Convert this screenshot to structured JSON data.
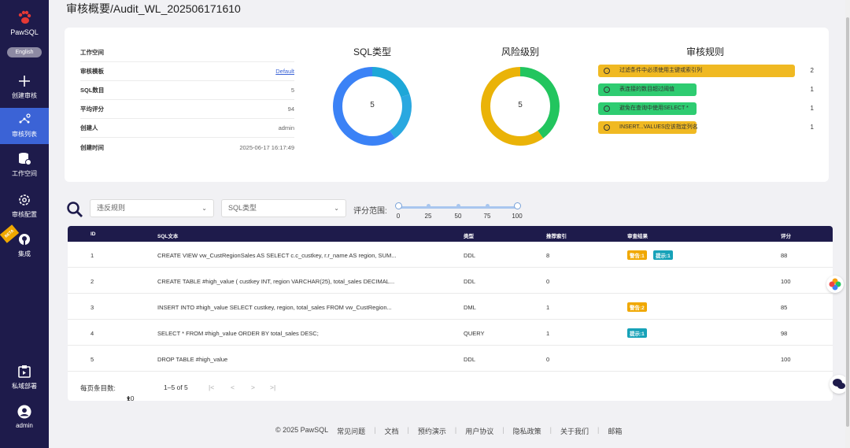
{
  "sidebar": {
    "app_name": "PawSQL",
    "language_button": "English",
    "items": [
      {
        "label": "创建审核",
        "icon": "plus-icon"
      },
      {
        "label": "审核列表",
        "icon": "audit-list-icon"
      },
      {
        "label": "工作空间",
        "icon": "database-icon"
      },
      {
        "label": "审核配置",
        "icon": "gear-icon"
      },
      {
        "label": "集成",
        "icon": "github-icon",
        "badge": "BETA"
      },
      {
        "label": "私域部署",
        "icon": "deploy-icon"
      },
      {
        "label": "admin",
        "icon": "user-avatar-icon"
      }
    ]
  },
  "page": {
    "title": "审核概要/Audit_WL_202506171610"
  },
  "summary": {
    "fields": [
      {
        "key": "工作空间",
        "value": ""
      },
      {
        "key": "审核模板",
        "value": "Default"
      },
      {
        "key": "SQL数目",
        "value": "5"
      },
      {
        "key": "平均评分",
        "value": "94"
      },
      {
        "key": "创建人",
        "value": "admin"
      },
      {
        "key": "创建时间",
        "value": "2025-06-17 16:17:49"
      }
    ],
    "sql_type_title": "SQL类型",
    "sql_type_center": "5",
    "risk_title": "风险级别",
    "risk_center": "5",
    "rules_title": "审核规则",
    "rules": [
      {
        "text": "过滤条件中必须使用主键或索引列",
        "count": "2",
        "color": "#f0b922",
        "fraction": 0.48
      },
      {
        "text": "表连接的数目超过阈值",
        "count": "1",
        "color": "#2ecc71",
        "fraction": 0.24
      },
      {
        "text": "避免在查询中使用SELECT *",
        "count": "1",
        "color": "#2ecc71",
        "fraction": 0.24
      },
      {
        "text": "INSERT...VALUES应该指定列名",
        "count": "1",
        "color": "#f0b922",
        "fraction": 0.24
      }
    ]
  },
  "chart_data": [
    {
      "type": "pie",
      "title": "SQL类型",
      "center_label": "5",
      "values": [
        1,
        1,
        3
      ],
      "colors": [
        "#1ea7d8",
        "#2aa8e0",
        "#3b82f6"
      ]
    },
    {
      "type": "pie",
      "title": "风险级别",
      "center_label": "5",
      "values": [
        2,
        3
      ],
      "colors": [
        "#22c55e",
        "#eab308"
      ]
    }
  ],
  "filters": {
    "rule_placeholder": "违反规则",
    "sql_type_placeholder": "SQL类型",
    "score_range_label": "评分范围:",
    "ticks": [
      "0",
      "25",
      "50",
      "75",
      "100"
    ],
    "range": [
      0,
      100
    ]
  },
  "table": {
    "headers": [
      "ID",
      "SQL文本",
      "类型",
      "推荐索引",
      "审查结果",
      "评分"
    ],
    "rows": [
      {
        "id": "1",
        "sql": "CREATE VIEW vw_CustRegionSales AS SELECT c.c_custkey, r.r_name AS region, SUM...",
        "type": "DDL",
        "idx": "8",
        "badges": [
          {
            "t": "警告:1",
            "k": "warn"
          },
          {
            "t": "提示:1",
            "k": "hint"
          }
        ],
        "score": "88"
      },
      {
        "id": "2",
        "sql": "CREATE TABLE #high_value ( custkey INT, region VARCHAR(25), total_sales DECIMAL...",
        "type": "DDL",
        "idx": "0",
        "badges": [],
        "score": "100"
      },
      {
        "id": "3",
        "sql": "INSERT INTO #high_value SELECT custkey, region, total_sales FROM vw_CustRegion...",
        "type": "DML",
        "idx": "1",
        "badges": [
          {
            "t": "警告:2",
            "k": "warn"
          }
        ],
        "score": "85"
      },
      {
        "id": "4",
        "sql": "SELECT * FROM #high_value ORDER BY total_sales DESC;",
        "type": "QUERY",
        "idx": "1",
        "badges": [
          {
            "t": "提示:1",
            "k": "hint"
          }
        ],
        "score": "98"
      },
      {
        "id": "5",
        "sql": "DROP TABLE #high_value",
        "type": "DDL",
        "idx": "0",
        "badges": [],
        "score": "100"
      }
    ],
    "pager": {
      "rows_per_page_label": "每页条目数:",
      "rows_per_page": "10",
      "range_text": "1–5 of 5",
      "first": "|<",
      "prev": "<",
      "next": ">",
      "last": ">|"
    }
  },
  "footer": {
    "copyright": "© 2025 PawSQL",
    "links": [
      "常见问题",
      "文档",
      "预约演示",
      "用户协议",
      "隐私政策",
      "关于我们",
      "邮箱"
    ]
  }
}
